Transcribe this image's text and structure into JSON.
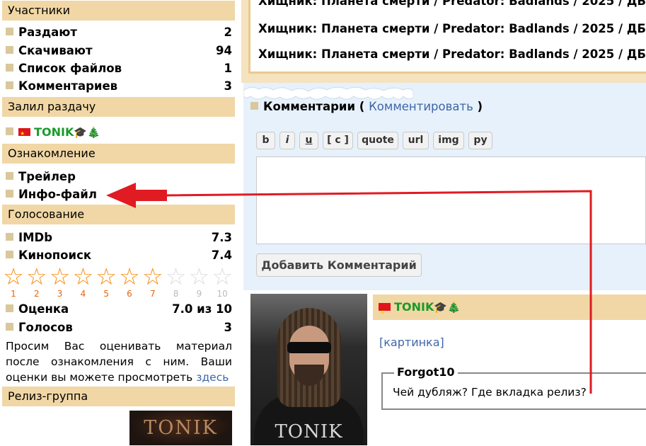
{
  "sidebar": {
    "participants": {
      "title": "Участники",
      "rows": [
        {
          "label": "Раздают",
          "value": "2"
        },
        {
          "label": "Скачивают",
          "value": "94"
        },
        {
          "label": "Список файлов",
          "value": "1"
        },
        {
          "label": "Комментариев",
          "value": "3"
        }
      ]
    },
    "uploader": {
      "title": "Залил раздачу",
      "username": "TONIK",
      "badges": "🎓🎄"
    },
    "preview": {
      "title": "Ознакомление",
      "links": [
        "Трейлер",
        "Инфо-файл"
      ]
    },
    "voting": {
      "title": "Голосование",
      "ratings": [
        {
          "label": "IMDb",
          "value": "7.3"
        },
        {
          "label": "Кинопоиск",
          "value": "7.4"
        }
      ],
      "stars": {
        "selected": 7,
        "max": 10,
        "labels": [
          "1",
          "2",
          "3",
          "4",
          "5",
          "6",
          "7",
          "8",
          "9",
          "10"
        ]
      },
      "score_label": "Оценка",
      "score_value": "7.0 из 10",
      "votes_label": "Голосов",
      "votes_value": "3",
      "note": "Просим Вас оценивать материал после ознакомления с ним. Ваши оценки вы можете просмотреть",
      "note_link": "здесь"
    },
    "release_group": {
      "title": "Релиз-группа",
      "logo_text": "TONIK"
    }
  },
  "downloads": {
    "lines": [
      "Хищник: Планета смерти / Predator: Badlands / 2025 / ДБ",
      "Хищник: Планета смерти / Predator: Badlands / 2025 / ДБ",
      "Хищник: Планета смерти / Predator: Badlands / 2025 / ДБ"
    ]
  },
  "comments": {
    "title": "Комментарии",
    "open_paren": "(",
    "link": "Комментировать",
    "close_paren": ")",
    "toolbar": [
      "b",
      "i",
      "u",
      "[ c ]",
      "quote",
      "url",
      "img",
      "ру"
    ],
    "submit_label": "Добавить Комментарий"
  },
  "post": {
    "avatar_watermark": "TONIK",
    "author": "TONIK",
    "author_badges": "🎓🎄",
    "picture_link": "[картинка]",
    "quote_author": "Forgot10",
    "quote_text": "Чей дубляж? Где вкладка релиз?"
  },
  "colors": {
    "section_header": "#f1d7a5",
    "comments_bg": "#e6f1fb",
    "link": "#3f66a8",
    "username": "#1a9a2a",
    "star_on": "#fa8a0b",
    "star_off": "#dcdcdc",
    "annotation_arrow": "#e01b22"
  }
}
